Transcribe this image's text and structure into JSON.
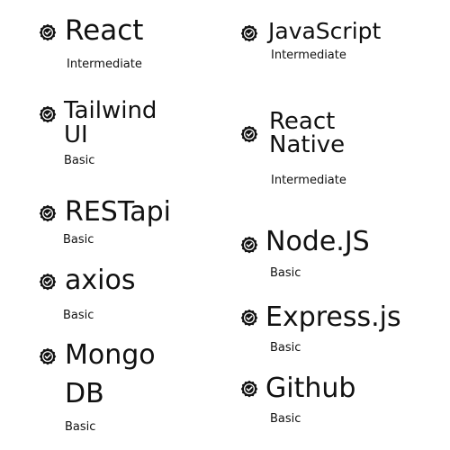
{
  "left_column": [
    {
      "name": "React",
      "level": "Intermediate"
    },
    {
      "name_lines": [
        "Tailwind",
        "UI"
      ],
      "level": "Basic"
    },
    {
      "name": "RESTapi",
      "level": "Basic"
    },
    {
      "name": "axios",
      "level": "Basic"
    },
    {
      "name_lines": [
        "Mongo",
        "DB"
      ],
      "level": "Basic"
    }
  ],
  "right_column": [
    {
      "name": "JavaScript",
      "level": "Intermediate"
    },
    {
      "name_lines": [
        "React",
        "Native"
      ],
      "level": "Intermediate"
    },
    {
      "name": "Node.JS",
      "level": "Basic"
    },
    {
      "name": "Express.js",
      "level": "Basic"
    },
    {
      "name": "Github",
      "level": "Basic"
    }
  ],
  "icon": {
    "name": "verified-badge-icon",
    "color": "#111111"
  }
}
